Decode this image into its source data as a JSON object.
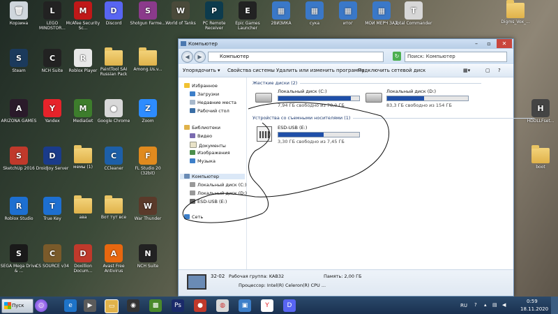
{
  "desktop": {
    "icons": [
      {
        "label": "Корзина",
        "kind": "app",
        "color": "#cfd6dc",
        "glyph": "🗑"
      },
      {
        "label": "LEGO MINDSTOR...",
        "kind": "app",
        "color": "#222",
        "glyph": "L"
      },
      {
        "label": "McAfee Security Sc...",
        "kind": "app",
        "color": "#c01818",
        "glyph": "M"
      },
      {
        "label": "Discord",
        "kind": "app",
        "color": "#5865f2",
        "glyph": "D"
      },
      {
        "label": "Shotgun Farme...",
        "kind": "app",
        "color": "#8b3a8b",
        "glyph": "S"
      },
      {
        "label": "World of Tanks",
        "kind": "app",
        "color": "#4a4a3a",
        "glyph": "W"
      },
      {
        "label": "PC Remote Receiver",
        "kind": "app",
        "color": "#0d3b4d",
        "glyph": "P"
      },
      {
        "label": "Epic Games Launcher",
        "kind": "app",
        "color": "#222",
        "glyph": "E"
      },
      {
        "label": "2ВИЗИКА",
        "kind": "app",
        "color": "#3a78c8",
        "glyph": "▦"
      },
      {
        "label": "сука",
        "kind": "app",
        "color": "#3a78c8",
        "glyph": "▦"
      },
      {
        "label": "итог",
        "kind": "app",
        "color": "#3a78c8",
        "glyph": "▦"
      },
      {
        "label": "МОЙ МЕРЧ ЗАД",
        "kind": "app",
        "color": "#3a78c8",
        "glyph": "▦"
      },
      {
        "label": "Total Commander",
        "kind": "app",
        "color": "#d7d7d7",
        "glyph": "T"
      },
      {
        "label": "Digms_Vox_...",
        "kind": "folder"
      },
      {
        "label": "Steam",
        "kind": "app",
        "color": "#1b3a5c",
        "glyph": "S"
      },
      {
        "label": "NCH Suite",
        "kind": "app",
        "color": "#222",
        "glyph": "C"
      },
      {
        "label": "Roblox Player",
        "kind": "app",
        "color": "#e8e8e8",
        "glyph": "R"
      },
      {
        "label": "PaintTool SAI Russian Pack",
        "kind": "folder"
      },
      {
        "label": "Among.Us.v...",
        "kind": "folder"
      },
      {
        "label": "ARIZONA GAMES",
        "kind": "app",
        "color": "#2a1a2a",
        "glyph": "A"
      },
      {
        "label": "Yandex",
        "kind": "app",
        "color": "#e6232a",
        "glyph": "Y"
      },
      {
        "label": "MediaGet",
        "kind": "app",
        "color": "#3d7d2c",
        "glyph": "M"
      },
      {
        "label": "Google Chrome",
        "kind": "app",
        "color": "#d8d8d8",
        "glyph": "●"
      },
      {
        "label": "Zoom",
        "kind": "app",
        "color": "#2d8cff",
        "glyph": "Z"
      },
      {
        "label": "HDDLLFset...",
        "kind": "app",
        "color": "#444",
        "glyph": "H"
      },
      {
        "label": "SketchUp 2016",
        "kind": "app",
        "color": "#c0392b",
        "glyph": "S"
      },
      {
        "label": "DroidJoy Server",
        "kind": "app",
        "color": "#1a3b8a",
        "glyph": "D"
      },
      {
        "label": "мемы (1)",
        "kind": "folder"
      },
      {
        "label": "CCleaner",
        "kind": "app",
        "color": "#1d5fa8",
        "glyph": "C"
      },
      {
        "label": "FL Studio 20 (32bit)",
        "kind": "app",
        "color": "#e08a1e",
        "glyph": "F"
      },
      {
        "label": "boot",
        "kind": "folder"
      },
      {
        "label": "Roblox Studio",
        "kind": "app",
        "color": "#1d6fd1",
        "glyph": "R"
      },
      {
        "label": "True Key",
        "kind": "app",
        "color": "#1d6fd1",
        "glyph": "T"
      },
      {
        "label": "ава",
        "kind": "folder"
      },
      {
        "label": "Вот тут все",
        "kind": "folder"
      },
      {
        "label": "War Thunder",
        "kind": "app",
        "color": "#5a3a2a",
        "glyph": "W"
      },
      {
        "label": "SEGA Mega Drive & ...",
        "kind": "app",
        "color": "#1a1a1a",
        "glyph": "S"
      },
      {
        "label": "CS SOURCE v34",
        "kind": "app",
        "color": "#7a5a2a",
        "glyph": "C"
      },
      {
        "label": "Doxillion Docum...",
        "kind": "app",
        "color": "#c0392b",
        "glyph": "D"
      },
      {
        "label": "Avast Free Antivirus",
        "kind": "app",
        "color": "#e8670f",
        "glyph": "A"
      },
      {
        "label": "NCH Suite",
        "kind": "app",
        "color": "#222",
        "glyph": "N"
      }
    ]
  },
  "window": {
    "title": "Компьютер",
    "address": "Компьютер",
    "search_placeholder": "Поиск: Компьютер",
    "toolbar": [
      "Упорядочить ▾",
      "Свойства системы",
      "Удалить или изменить программу",
      "Подключить сетевой диск"
    ],
    "nav": {
      "favorites": "Избранное",
      "fav_items": [
        "Загрузки",
        "Недавние места",
        "Рабочий стол"
      ],
      "libraries": "Библиотеки",
      "lib_items": [
        "Видео",
        "Документы",
        "Изображения",
        "Музыка"
      ],
      "computer": "Компьютер",
      "comp_items": [
        "Локальный диск (C:)",
        "Локальный диск (D:)",
        "ESD-USB (E:)"
      ],
      "network": "Сеть"
    },
    "hard_drives_header": "Жесткие диски (2)",
    "removable_header": "Устройства со съемными носителями (1)",
    "drives": [
      {
        "name": "Локальный диск (C:)",
        "free": "7,94 ГБ свободно из 78,0 ГБ",
        "used_fraction": 0.9
      },
      {
        "name": "Локальный диск (D:)",
        "free": "83,3 ГБ свободно из 154 ГБ",
        "used_fraction": 0.46
      },
      {
        "name": "ESD-USB (E:)",
        "free": "3,30 ГБ свободно из 7,45 ГБ",
        "used_fraction": 0.56
      }
    ],
    "details": {
      "name": "32-02",
      "workgroup": "Рабочая группа: KAB32",
      "memory": "Память: 2,00 ГБ",
      "cpu": "Процессор: Intel(R) Celeron(R) CPU ..."
    }
  },
  "taskbar": {
    "start": "Пуск",
    "lang": "RU",
    "time": "0:59",
    "date": "18.11.2020"
  }
}
